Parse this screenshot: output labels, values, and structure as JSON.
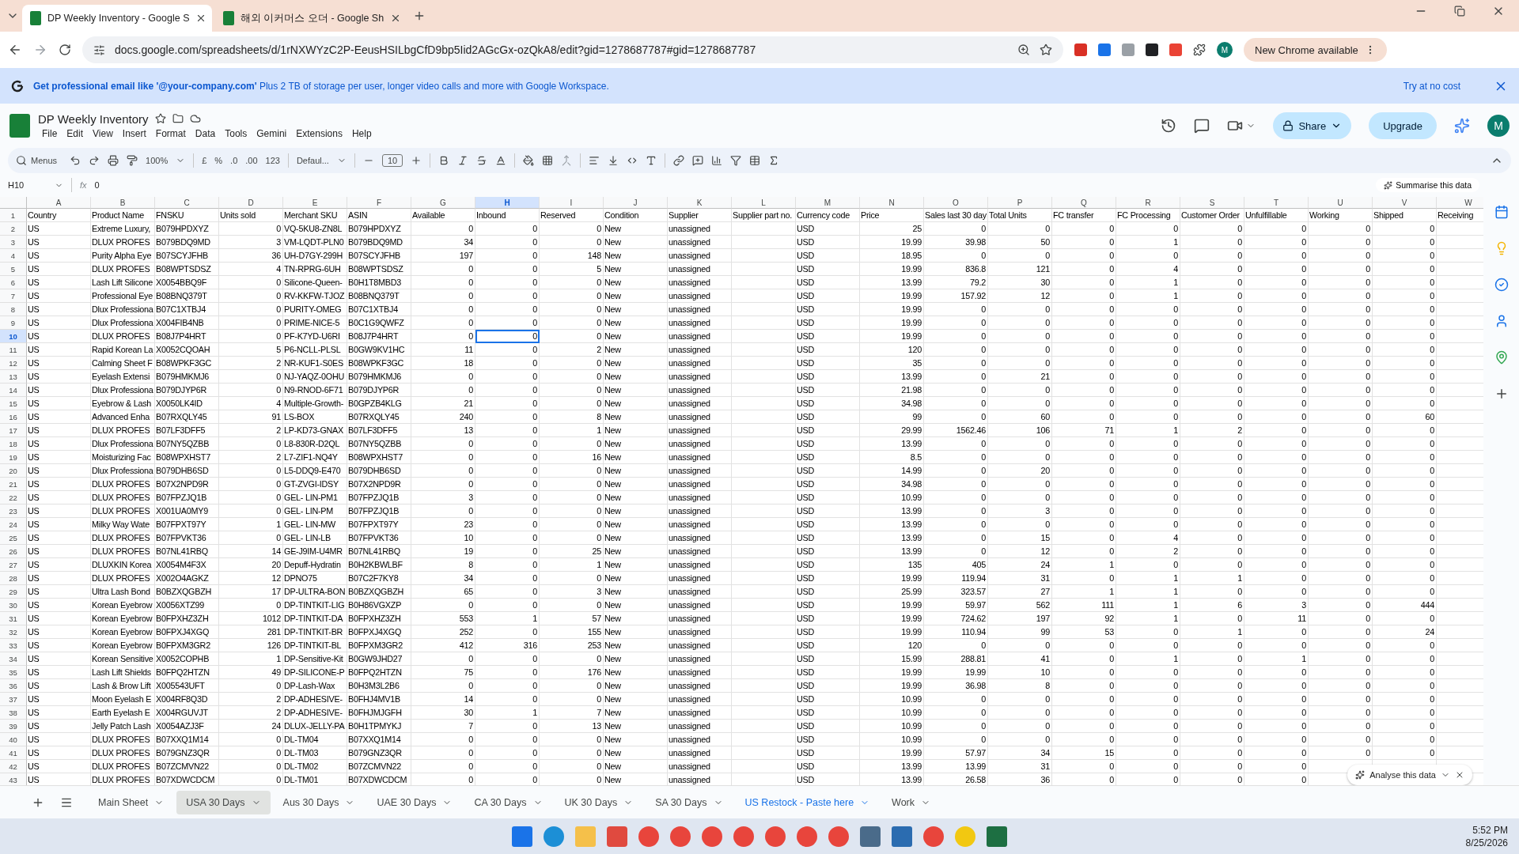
{
  "browser": {
    "tabs": [
      {
        "title": "DP Weekly Inventory - Google S",
        "selected": true
      },
      {
        "title": "해외 이커머스 오더 - Google Sh",
        "selected": false
      }
    ],
    "url": "docs.google.com/spreadsheets/d/1rNXWYzC2P-EeusHSILbgCfD9bp5Iid2AGcGx-ozQkA8/edit?gid=1278687787#gid=1278687787",
    "profile": "M",
    "update_button": "New Chrome available"
  },
  "promo": {
    "text": "**Get professional email like '@your-company.com'** Plus 2 TB of storage per user, longer video calls and more with Google Workspace.",
    "action": "Try at no cost"
  },
  "doc": {
    "title": "DP Weekly Inventory",
    "menus": [
      "File",
      "Edit",
      "View",
      "Insert",
      "Format",
      "Data",
      "Tools",
      "Gemini",
      "Extensions",
      "Help"
    ],
    "share": "Share",
    "upgrade": "Upgrade",
    "avatar": "M"
  },
  "toolbar": {
    "search": "Menus",
    "zoom": "100%",
    "currency": "£",
    "percent": "%",
    "decrease_decimal": ".0",
    "increase_decimal": ".00",
    "number_format": "123",
    "font": "Defaul...",
    "font_size": "10"
  },
  "formula_bar": {
    "cell_ref": "H10",
    "label": "fx",
    "value": "0",
    "summarise": "Summarise this data"
  },
  "sheet": {
    "columns": [
      {
        "letter": "A",
        "numeric": false,
        "selected": false
      },
      {
        "letter": "B",
        "numeric": false,
        "selected": false
      },
      {
        "letter": "C",
        "numeric": false,
        "selected": false
      },
      {
        "letter": "D",
        "numeric": true,
        "selected": false
      },
      {
        "letter": "E",
        "numeric": false,
        "selected": false
      },
      {
        "letter": "F",
        "numeric": false,
        "selected": false
      },
      {
        "letter": "G",
        "numeric": true,
        "selected": false
      },
      {
        "letter": "H",
        "numeric": true,
        "selected": true
      },
      {
        "letter": "I",
        "numeric": true,
        "selected": false
      },
      {
        "letter": "J",
        "numeric": false,
        "selected": false
      },
      {
        "letter": "K",
        "numeric": false,
        "selected": false
      },
      {
        "letter": "L",
        "numeric": false,
        "selected": false
      },
      {
        "letter": "M",
        "numeric": false,
        "selected": false
      },
      {
        "letter": "N",
        "numeric": true,
        "selected": false
      },
      {
        "letter": "O",
        "numeric": true,
        "selected": false
      },
      {
        "letter": "P",
        "numeric": true,
        "selected": false
      },
      {
        "letter": "Q",
        "numeric": true,
        "selected": false
      },
      {
        "letter": "R",
        "numeric": true,
        "selected": false
      },
      {
        "letter": "S",
        "numeric": true,
        "selected": false
      },
      {
        "letter": "T",
        "numeric": true,
        "selected": false
      },
      {
        "letter": "U",
        "numeric": true,
        "selected": false
      },
      {
        "letter": "V",
        "numeric": true,
        "selected": false
      },
      {
        "letter": "W",
        "numeric": true,
        "selected": false
      }
    ],
    "rows": [
      {
        "number": "1",
        "kind": "header",
        "selected": false,
        "cells": [
          "Country",
          "Product Name",
          "FNSKU",
          "Units sold",
          "Merchant SKU",
          "ASIN",
          "Available",
          "Inbound",
          "Reserved",
          "Condition",
          "Supplier",
          "Supplier part no.",
          "Currency code",
          "Price",
          "Sales last 30 day",
          "Total Units",
          "FC transfer",
          "FC Processing",
          "Customer Order",
          "Unfulfillable",
          "Working",
          "Shipped",
          "Receiving"
        ]
      },
      {
        "number": "2",
        "kind": "data",
        "selected": false,
        "cells": [
          "US",
          "Extreme Luxury,",
          "B079HPDXYZ",
          "0",
          "VQ-5KU8-ZN8L",
          "B079HPDXYZ",
          "0",
          "0",
          "0",
          "New",
          "unassigned",
          null,
          "USD",
          "25",
          "0",
          "0",
          "0",
          "0",
          "0",
          "0",
          "0",
          "0",
          null
        ]
      },
      {
        "number": "3",
        "kind": "data",
        "selected": false,
        "cells": [
          "US",
          "DLUX PROFES",
          "B079BDQ9MD",
          "3",
          "VM-LQDT-PLN0",
          "B079BDQ9MD",
          "34",
          "0",
          "0",
          "New",
          "unassigned",
          null,
          "USD",
          "19.99",
          "39.98",
          "50",
          "0",
          "1",
          "0",
          "0",
          "0",
          "0",
          null
        ]
      },
      {
        "number": "4",
        "kind": "data",
        "selected": false,
        "cells": [
          "US",
          "Purity Alpha Eye",
          "B07SCYJFHB",
          "36",
          "UH-D7GY-299H",
          "B07SCYJFHB",
          "197",
          "0",
          "148",
          "New",
          "unassigned",
          null,
          "USD",
          "18.95",
          "0",
          "0",
          "0",
          "0",
          "0",
          "0",
          "0",
          "0",
          null
        ]
      },
      {
        "number": "5",
        "kind": "data",
        "selected": false,
        "cells": [
          "US",
          "DLUX PROFES",
          "B08WPTSDSZ",
          "4",
          "TN-RPRG-6UH",
          "B08WPTSDSZ",
          "0",
          "0",
          "5",
          "New",
          "unassigned",
          null,
          "USD",
          "19.99",
          "836.8",
          "121",
          "0",
          "4",
          "0",
          "0",
          "0",
          "0",
          null
        ]
      },
      {
        "number": "6",
        "kind": "data",
        "selected": false,
        "cells": [
          "US",
          "Lash Lift Silicone",
          "X0054BBQ9F",
          "0",
          "Silicone-Queen-",
          "B0H1T8MBD3",
          "0",
          "0",
          "0",
          "New",
          "unassigned",
          null,
          "USD",
          "13.99",
          "79.2",
          "30",
          "0",
          "1",
          "0",
          "0",
          "0",
          "0",
          null
        ]
      },
      {
        "number": "7",
        "kind": "data",
        "selected": false,
        "cells": [
          "US",
          "Professional Eye",
          "B08BNQ379T",
          "0",
          "RV-KKFW-TJOZ",
          "B08BNQ379T",
          "0",
          "0",
          "0",
          "New",
          "unassigned",
          null,
          "USD",
          "19.99",
          "157.92",
          "12",
          "0",
          "1",
          "0",
          "0",
          "0",
          "0",
          null
        ]
      },
      {
        "number": "8",
        "kind": "data",
        "selected": false,
        "cells": [
          "US",
          "Dlux Professiona",
          "B07C1XTBJ4",
          "0",
          "PURITY-OMEG",
          "B07C1XTBJ4",
          "0",
          "0",
          "0",
          "New",
          "unassigned",
          null,
          "USD",
          "19.99",
          "0",
          "0",
          "0",
          "0",
          "0",
          "0",
          "0",
          "0",
          null
        ]
      },
      {
        "number": "9",
        "kind": "data",
        "selected": false,
        "cells": [
          "US",
          "Dlux Professiona",
          "X004FIB4NB",
          "0",
          "PRIME-NICE-5",
          "B0C1G9QWFZ",
          "0",
          "0",
          "0",
          "New",
          "unassigned",
          null,
          "USD",
          "19.99",
          "0",
          "0",
          "0",
          "0",
          "0",
          "0",
          "0",
          "0",
          null
        ]
      },
      {
        "number": "10",
        "kind": "data",
        "selected": true,
        "cells": [
          "US",
          "DLUX PROFES",
          "B08J7P4HRT",
          "0",
          "PF-K7YD-U6RI",
          "B08J7P4HRT",
          "0",
          "0",
          "0",
          "New",
          "unassigned",
          null,
          "USD",
          "19.99",
          "0",
          "0",
          "0",
          "0",
          "0",
          "0",
          "0",
          "0",
          null
        ]
      },
      {
        "number": "11",
        "kind": "data",
        "selected": false,
        "cells": [
          "US",
          "Rapid Korean La",
          "X0052CQOAH",
          "5",
          "P6-NCLL-PLSL",
          "B0GW9KV1HC",
          "11",
          "0",
          "2",
          "New",
          "unassigned",
          null,
          "USD",
          "120",
          "0",
          "0",
          "0",
          "0",
          "0",
          "0",
          "0",
          "0",
          null
        ]
      },
      {
        "number": "12",
        "kind": "data",
        "selected": false,
        "cells": [
          "US",
          "Calming Sheet F",
          "B08WPKF3GC",
          "2",
          "NR-KUF1-S0ES",
          "B08WPKF3GC",
          "18",
          "0",
          "0",
          "New",
          "unassigned",
          null,
          "USD",
          "35",
          "0",
          "0",
          "0",
          "0",
          "0",
          "0",
          "0",
          "0",
          null
        ]
      },
      {
        "number": "13",
        "kind": "data",
        "selected": false,
        "cells": [
          "US",
          "Eyelash Extensi",
          "B079HMKMJ6",
          "0",
          "NJ-YAQZ-0OHU",
          "B079HMKMJ6",
          "0",
          "0",
          "0",
          "New",
          "unassigned",
          null,
          "USD",
          "13.99",
          "0",
          "21",
          "0",
          "0",
          "0",
          "0",
          "0",
          "0",
          null
        ]
      },
      {
        "number": "14",
        "kind": "data",
        "selected": false,
        "cells": [
          "US",
          "Dlux Professiona",
          "B079DJYP6R",
          "0",
          "N9-RNOD-6F71",
          "B079DJYP6R",
          "0",
          "0",
          "0",
          "New",
          "unassigned",
          null,
          "USD",
          "21.98",
          "0",
          "0",
          "0",
          "0",
          "0",
          "0",
          "0",
          "0",
          null
        ]
      },
      {
        "number": "15",
        "kind": "data",
        "selected": false,
        "cells": [
          "US",
          "Eyebrow & Lash",
          "X0050LK4ID",
          "4",
          "Multiple-Growth-",
          "B0GPZB4KLG",
          "21",
          "0",
          "0",
          "New",
          "unassigned",
          null,
          "USD",
          "34.98",
          "0",
          "0",
          "0",
          "0",
          "0",
          "0",
          "0",
          "0",
          null
        ]
      },
      {
        "number": "16",
        "kind": "data",
        "selected": false,
        "cells": [
          "US",
          "Advanced Enha",
          "B07RXQLY45",
          "91",
          "LS-BOX",
          "B07RXQLY45",
          "240",
          "0",
          "8",
          "New",
          "unassigned",
          null,
          "USD",
          "99",
          "0",
          "60",
          "0",
          "0",
          "0",
          "0",
          "0",
          "60",
          null
        ]
      },
      {
        "number": "17",
        "kind": "data",
        "selected": false,
        "cells": [
          "US",
          "DLUX PROFES",
          "B07LF3DFF5",
          "2",
          "LP-KD73-GNAX",
          "B07LF3DFF5",
          "13",
          "0",
          "1",
          "New",
          "unassigned",
          null,
          "USD",
          "29.99",
          "1562.46",
          "106",
          "71",
          "1",
          "2",
          "0",
          "0",
          "0",
          null
        ]
      },
      {
        "number": "18",
        "kind": "data",
        "selected": false,
        "cells": [
          "US",
          "Dlux Professiona",
          "B07NY5QZBB",
          "0",
          "L8-830R-D2QL",
          "B07NY5QZBB",
          "0",
          "0",
          "0",
          "New",
          "unassigned",
          null,
          "USD",
          "13.99",
          "0",
          "0",
          "0",
          "0",
          "0",
          "0",
          "0",
          "0",
          null
        ]
      },
      {
        "number": "19",
        "kind": "data",
        "selected": false,
        "cells": [
          "US",
          "Moisturizing Fac",
          "B08WPXHST7",
          "2",
          "L7-ZIF1-NQ4Y",
          "B08WPXHST7",
          "0",
          "0",
          "16",
          "New",
          "unassigned",
          null,
          "USD",
          "8.5",
          "0",
          "0",
          "0",
          "0",
          "0",
          "0",
          "0",
          "0",
          null
        ]
      },
      {
        "number": "20",
        "kind": "data",
        "selected": false,
        "cells": [
          "US",
          "Dlux Professiona",
          "B079DHB6SD",
          "0",
          "L5-DDQ9-E470",
          "B079DHB6SD",
          "0",
          "0",
          "0",
          "New",
          "unassigned",
          null,
          "USD",
          "14.99",
          "0",
          "20",
          "0",
          "0",
          "0",
          "0",
          "0",
          "0",
          null
        ]
      },
      {
        "number": "21",
        "kind": "data",
        "selected": false,
        "cells": [
          "US",
          "DLUX PROFES",
          "B07X2NPD9R",
          "0",
          "GT-ZVGI-IDSY",
          "B07X2NPD9R",
          "0",
          "0",
          "0",
          "New",
          "unassigned",
          null,
          "USD",
          "34.98",
          "0",
          "0",
          "0",
          "0",
          "0",
          "0",
          "0",
          "0",
          null
        ]
      },
      {
        "number": "22",
        "kind": "data",
        "selected": false,
        "cells": [
          "US",
          "DLUX PROFES",
          "B07FPZJQ1B",
          "0",
          "GEL- LIN-PM1",
          "B07FPZJQ1B",
          "3",
          "0",
          "0",
          "New",
          "unassigned",
          null,
          "USD",
          "10.99",
          "0",
          "0",
          "0",
          "0",
          "0",
          "0",
          "0",
          "0",
          null
        ]
      },
      {
        "number": "23",
        "kind": "data",
        "selected": false,
        "cells": [
          "US",
          "DLUX PROFES",
          "X001UA0MY9",
          "0",
          "GEL- LIN-PM",
          "B07FPZJQ1B",
          "0",
          "0",
          "0",
          "New",
          "unassigned",
          null,
          "USD",
          "13.99",
          "0",
          "3",
          "0",
          "0",
          "0",
          "0",
          "0",
          "0",
          null
        ]
      },
      {
        "number": "24",
        "kind": "data",
        "selected": false,
        "cells": [
          "US",
          "Milky Way Wate",
          "B07FPXT97Y",
          "1",
          "GEL- LIN-MW",
          "B07FPXT97Y",
          "23",
          "0",
          "0",
          "New",
          "unassigned",
          null,
          "USD",
          "13.99",
          "0",
          "0",
          "0",
          "0",
          "0",
          "0",
          "0",
          "0",
          null
        ]
      },
      {
        "number": "25",
        "kind": "data",
        "selected": false,
        "cells": [
          "US",
          "DLUX PROFES",
          "B07FPVKT36",
          "0",
          "GEL- LIN-LB",
          "B07FPVKT36",
          "10",
          "0",
          "0",
          "New",
          "unassigned",
          null,
          "USD",
          "13.99",
          "0",
          "15",
          "0",
          "4",
          "0",
          "0",
          "0",
          "0",
          null
        ]
      },
      {
        "number": "26",
        "kind": "data",
        "selected": false,
        "cells": [
          "US",
          "DLUX PROFES",
          "B07NL41RBQ",
          "14",
          "GE-J9IM-U4MR",
          "B07NL41RBQ",
          "19",
          "0",
          "25",
          "New",
          "unassigned",
          null,
          "USD",
          "13.99",
          "0",
          "12",
          "0",
          "2",
          "0",
          "0",
          "0",
          "0",
          null
        ]
      },
      {
        "number": "27",
        "kind": "data",
        "selected": false,
        "cells": [
          "US",
          "DLUXKIN Korea",
          "X0054M4F3X",
          "20",
          "Depuff-Hydratin",
          "B0H2KBWLBF",
          "8",
          "0",
          "1",
          "New",
          "unassigned",
          null,
          "USD",
          "135",
          "405",
          "24",
          "1",
          "0",
          "0",
          "0",
          "0",
          "0",
          null
        ]
      },
      {
        "number": "28",
        "kind": "data",
        "selected": false,
        "cells": [
          "US",
          "DLUX PROFES",
          "X002O4AGKZ",
          "12",
          "DPNO75",
          "B07C2F7KY8",
          "34",
          "0",
          "0",
          "New",
          "unassigned",
          null,
          "USD",
          "19.99",
          "119.94",
          "31",
          "0",
          "1",
          "1",
          "0",
          "0",
          "0",
          null
        ]
      },
      {
        "number": "29",
        "kind": "data",
        "selected": false,
        "cells": [
          "US",
          "Ultra Lash Bond",
          "B0BZXQGBZH",
          "17",
          "DP-ULTRA-BON",
          "B0BZXQGBZH",
          "65",
          "0",
          "3",
          "New",
          "unassigned",
          null,
          "USD",
          "25.99",
          "323.57",
          "27",
          "1",
          "1",
          "0",
          "0",
          "0",
          "0",
          null
        ]
      },
      {
        "number": "30",
        "kind": "data",
        "selected": false,
        "cells": [
          "US",
          "Korean Eyebrow",
          "X0056XTZ99",
          "0",
          "DP-TINTKIT-LIG",
          "B0H86VGXZP",
          "0",
          "0",
          "0",
          "New",
          "unassigned",
          null,
          "USD",
          "19.99",
          "59.97",
          "562",
          "111",
          "1",
          "6",
          "3",
          "0",
          "444",
          null
        ]
      },
      {
        "number": "31",
        "kind": "data",
        "selected": false,
        "cells": [
          "US",
          "Korean Eyebrow",
          "B0FPXHZ3ZH",
          "1012",
          "DP-TINTKIT-DA",
          "B0FPXHZ3ZH",
          "553",
          "1",
          "57",
          "New",
          "unassigned",
          null,
          "USD",
          "19.99",
          "724.62",
          "197",
          "92",
          "1",
          "0",
          "11",
          "0",
          "0",
          null
        ]
      },
      {
        "number": "32",
        "kind": "data",
        "selected": false,
        "cells": [
          "US",
          "Korean Eyebrow",
          "B0FPXJ4XGQ",
          "281",
          "DP-TINTKIT-BR",
          "B0FPXJ4XGQ",
          "252",
          "0",
          "155",
          "New",
          "unassigned",
          null,
          "USD",
          "19.99",
          "110.94",
          "99",
          "53",
          "0",
          "1",
          "0",
          "0",
          "24",
          null
        ]
      },
      {
        "number": "33",
        "kind": "data",
        "selected": false,
        "cells": [
          "US",
          "Korean Eyebrow",
          "B0FPXM3GR2",
          "126",
          "DP-TINTKIT-BL",
          "B0FPXM3GR2",
          "412",
          "316",
          "253",
          "New",
          "unassigned",
          null,
          "USD",
          "120",
          "0",
          "0",
          "0",
          "0",
          "0",
          "0",
          "0",
          "0",
          null
        ]
      },
      {
        "number": "34",
        "kind": "data",
        "selected": false,
        "cells": [
          "US",
          "Korean Sensitive",
          "X0052COPHB",
          "1",
          "DP-Sensitive-Kit",
          "B0GW9JHD27",
          "0",
          "0",
          "0",
          "New",
          "unassigned",
          null,
          "USD",
          "15.99",
          "288.81",
          "41",
          "0",
          "1",
          "0",
          "1",
          "0",
          "0",
          null
        ]
      },
      {
        "number": "35",
        "kind": "data",
        "selected": false,
        "cells": [
          "US",
          "Lash Lift Shields",
          "B0FPQ2HTZN",
          "49",
          "DP-SILICONE-P",
          "B0FPQ2HTZN",
          "75",
          "0",
          "176",
          "New",
          "unassigned",
          null,
          "USD",
          "19.99",
          "19.99",
          "10",
          "0",
          "0",
          "0",
          "0",
          "0",
          "0",
          null
        ]
      },
      {
        "number": "36",
        "kind": "data",
        "selected": false,
        "cells": [
          "US",
          "Lash & Brow Lift",
          "X005543UFT",
          "0",
          "DP-Lash-Wax",
          "B0H3M3L2B6",
          "0",
          "0",
          "0",
          "New",
          "unassigned",
          null,
          "USD",
          "19.99",
          "36.98",
          "8",
          "0",
          "0",
          "0",
          "0",
          "0",
          "0",
          null
        ]
      },
      {
        "number": "37",
        "kind": "data",
        "selected": false,
        "cells": [
          "US",
          "Moon Eyelash E",
          "X004RF8Q3D",
          "2",
          "DP-ADHESIVE-",
          "B0FHJ4MV1B",
          "14",
          "0",
          "0",
          "New",
          "unassigned",
          null,
          "USD",
          "10.99",
          "0",
          "0",
          "0",
          "0",
          "0",
          "0",
          "0",
          "0",
          null
        ]
      },
      {
        "number": "38",
        "kind": "data",
        "selected": false,
        "cells": [
          "US",
          "Earth Eyelash E",
          "X004RGUVJT",
          "2",
          "DP-ADHESIVE-",
          "B0FHJMJGFH",
          "30",
          "1",
          "7",
          "New",
          "unassigned",
          null,
          "USD",
          "10.99",
          "0",
          "0",
          "0",
          "0",
          "0",
          "0",
          "0",
          "0",
          null
        ]
      },
      {
        "number": "39",
        "kind": "data",
        "selected": false,
        "cells": [
          "US",
          "Jelly Patch Lash",
          "X0054AZJ3F",
          "24",
          "DLUX-JELLY-PA",
          "B0H1TPMYKJ",
          "7",
          "0",
          "13",
          "New",
          "unassigned",
          null,
          "USD",
          "10.99",
          "0",
          "0",
          "0",
          "0",
          "0",
          "0",
          "0",
          "0",
          null
        ]
      },
      {
        "number": "40",
        "kind": "data",
        "selected": false,
        "cells": [
          "US",
          "DLUX PROFES",
          "B07XXQ1M14",
          "0",
          "DL-TM04",
          "B07XXQ1M14",
          "0",
          "0",
          "0",
          "New",
          "unassigned",
          null,
          "USD",
          "10.99",
          "0",
          "0",
          "0",
          "0",
          "0",
          "0",
          "0",
          "0",
          null
        ]
      },
      {
        "number": "41",
        "kind": "data",
        "selected": false,
        "cells": [
          "US",
          "DLUX PROFES",
          "B079GNZ3QR",
          "0",
          "DL-TM03",
          "B079GNZ3QR",
          "0",
          "0",
          "0",
          "New",
          "unassigned",
          null,
          "USD",
          "19.99",
          "57.97",
          "34",
          "15",
          "0",
          "0",
          "0",
          "0",
          "0",
          null
        ]
      },
      {
        "number": "42",
        "kind": "data",
        "selected": false,
        "cells": [
          "US",
          "DLUX PROFES",
          "B07ZCMVN22",
          "0",
          "DL-TM02",
          "B07ZCMVN22",
          "0",
          "0",
          "0",
          "New",
          "unassigned",
          null,
          "USD",
          "13.99",
          "13.99",
          "31",
          "0",
          "0",
          "0",
          "0",
          null,
          null,
          null
        ]
      },
      {
        "number": "43",
        "kind": "data",
        "selected": false,
        "cells": [
          "US",
          "DLUX PROFES",
          "B07XDWCDCM",
          "0",
          "DL-TM01",
          "B07XDWCDCM",
          "0",
          "0",
          "0",
          "New",
          "unassigned",
          null,
          "USD",
          "13.99",
          "26.58",
          "36",
          "0",
          "0",
          "0",
          "0",
          null,
          null,
          null
        ]
      }
    ]
  },
  "analyse": "Analyse this data",
  "sheet_tabs": [
    {
      "label": "Main Sheet",
      "selected": false,
      "color": "#444746"
    },
    {
      "label": "USA 30 Days",
      "selected": true,
      "color": "#444746"
    },
    {
      "label": "Aus 30 Days",
      "selected": false,
      "color": "#444746"
    },
    {
      "label": "UAE 30 Days",
      "selected": false,
      "color": "#444746"
    },
    {
      "label": "CA 30 Days",
      "selected": false,
      "color": "#444746"
    },
    {
      "label": "UK 30 Days",
      "selected": false,
      "color": "#444746"
    },
    {
      "label": "SA 30 Days",
      "selected": false,
      "color": "#444746"
    },
    {
      "label": "US Restock - Paste here",
      "selected": false,
      "color": "#1a73e8"
    },
    {
      "label": "Work",
      "selected": false,
      "color": "#444746"
    }
  ],
  "taskbar": {
    "time": "5:52 PM",
    "date": "8/25/2026"
  }
}
